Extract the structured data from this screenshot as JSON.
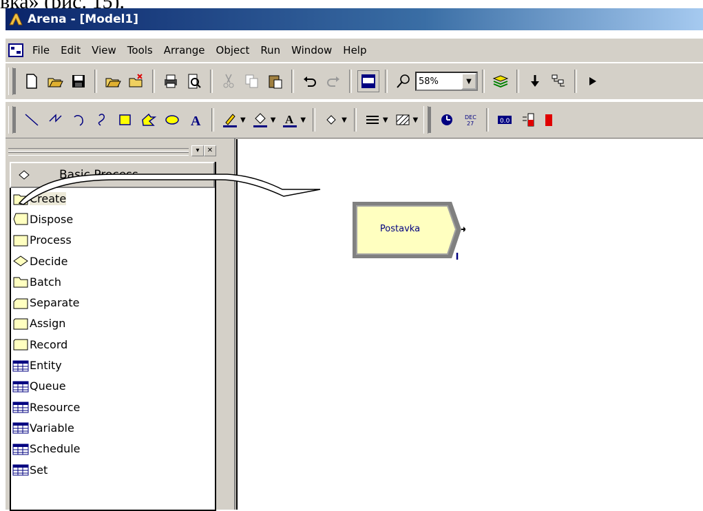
{
  "caption": "вка» (рис. 15).",
  "window": {
    "title": "Arena - [Model1]"
  },
  "menu": [
    "File",
    "Edit",
    "View",
    "Tools",
    "Arrange",
    "Object",
    "Run",
    "Window",
    "Help"
  ],
  "toolbar": {
    "zoom": "58%"
  },
  "project_bar": {
    "panel_title": "Basic Process",
    "modules": [
      {
        "label": "Create",
        "icon": "create-shape-icon"
      },
      {
        "label": "Dispose",
        "icon": "dispose-shape-icon"
      },
      {
        "label": "Process",
        "icon": "process-shape-icon"
      },
      {
        "label": "Decide",
        "icon": "decide-shape-icon"
      },
      {
        "label": "Batch",
        "icon": "batch-shape-icon"
      },
      {
        "label": "Separate",
        "icon": "separate-shape-icon"
      },
      {
        "label": "Assign",
        "icon": "assign-shape-icon"
      },
      {
        "label": "Record",
        "icon": "record-shape-icon"
      },
      {
        "label": "Entity",
        "icon": "spreadsheet-icon"
      },
      {
        "label": "Queue",
        "icon": "spreadsheet-icon"
      },
      {
        "label": "Resource",
        "icon": "spreadsheet-icon"
      },
      {
        "label": "Variable",
        "icon": "spreadsheet-icon"
      },
      {
        "label": "Schedule",
        "icon": "spreadsheet-icon"
      },
      {
        "label": "Set",
        "icon": "spreadsheet-icon"
      }
    ]
  },
  "canvas": {
    "module_label": "Postavka"
  }
}
